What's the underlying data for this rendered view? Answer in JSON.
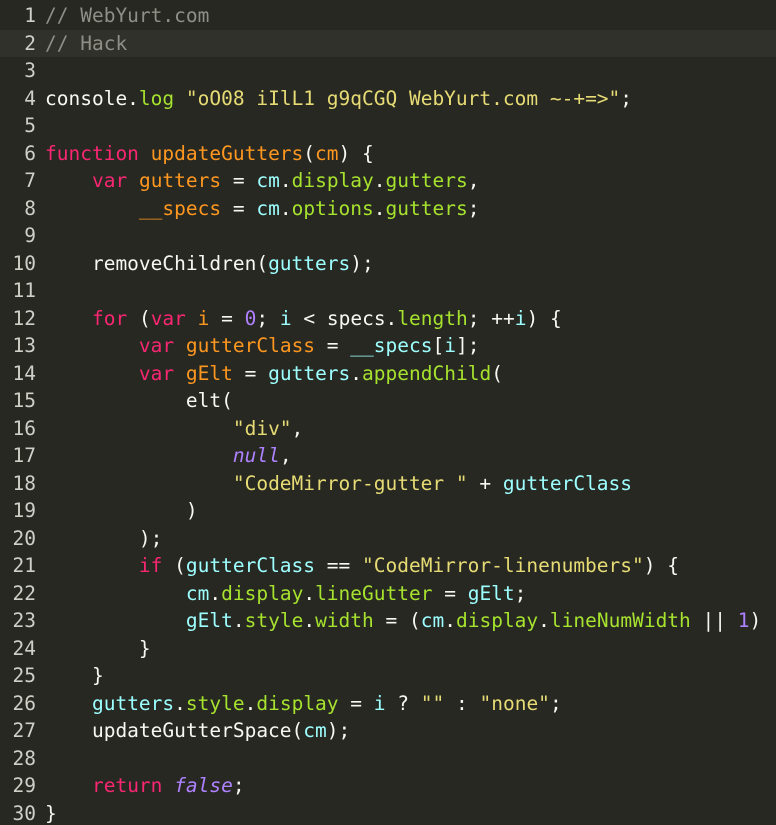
{
  "editor": {
    "theme": "monokai",
    "active_line": 2,
    "colors": {
      "background": "#272822",
      "active_line": "#30312b",
      "comment": "#8f8f87",
      "keyword": "#f92672",
      "definition": "#fd971f",
      "variable": "#a6e22e",
      "variable_2": "#9effff",
      "string": "#e6db74",
      "number": "#ae81ff"
    }
  },
  "lines": [
    [
      [
        "comment",
        "// WebYurt.com"
      ]
    ],
    [
      [
        "comment",
        "// Hack"
      ]
    ],
    [],
    [
      [
        "plain",
        "console."
      ],
      [
        "prop",
        "log"
      ],
      [
        "plain",
        " "
      ],
      [
        "string",
        "\"oO08 iIlL1 g9qCGQ WebYurt.com ~-+=>\""
      ],
      [
        "plain",
        ";"
      ]
    ],
    [],
    [
      [
        "keyword",
        "function"
      ],
      [
        "plain",
        " "
      ],
      [
        "def",
        "updateGutters"
      ],
      [
        "plain",
        "("
      ],
      [
        "def",
        "cm"
      ],
      [
        "plain",
        ") {"
      ]
    ],
    [
      [
        "plain",
        "    "
      ],
      [
        "keyword",
        "var"
      ],
      [
        "plain",
        " "
      ],
      [
        "def",
        "gutters"
      ],
      [
        "plain",
        " = "
      ],
      [
        "var2",
        "cm"
      ],
      [
        "plain",
        "."
      ],
      [
        "prop",
        "display"
      ],
      [
        "plain",
        "."
      ],
      [
        "prop",
        "gutters"
      ],
      [
        "plain",
        ","
      ]
    ],
    [
      [
        "plain",
        "        "
      ],
      [
        "def",
        "__specs"
      ],
      [
        "plain",
        " = "
      ],
      [
        "var2",
        "cm"
      ],
      [
        "plain",
        "."
      ],
      [
        "prop",
        "options"
      ],
      [
        "plain",
        "."
      ],
      [
        "prop",
        "gutters"
      ],
      [
        "plain",
        ";"
      ]
    ],
    [],
    [
      [
        "plain",
        "    removeChildren("
      ],
      [
        "var2",
        "gutters"
      ],
      [
        "plain",
        ");"
      ]
    ],
    [],
    [
      [
        "plain",
        "    "
      ],
      [
        "keyword",
        "for"
      ],
      [
        "plain",
        " ("
      ],
      [
        "keyword",
        "var"
      ],
      [
        "plain",
        " "
      ],
      [
        "def",
        "i"
      ],
      [
        "plain",
        " = "
      ],
      [
        "number",
        "0"
      ],
      [
        "plain",
        "; "
      ],
      [
        "var2",
        "i"
      ],
      [
        "plain",
        " < specs."
      ],
      [
        "prop",
        "length"
      ],
      [
        "plain",
        "; ++"
      ],
      [
        "var2",
        "i"
      ],
      [
        "plain",
        ") {"
      ]
    ],
    [
      [
        "plain",
        "        "
      ],
      [
        "keyword",
        "var"
      ],
      [
        "plain",
        " "
      ],
      [
        "def",
        "gutterClass"
      ],
      [
        "plain",
        " = "
      ],
      [
        "var2",
        "__specs"
      ],
      [
        "plain",
        "["
      ],
      [
        "var2",
        "i"
      ],
      [
        "plain",
        "];"
      ]
    ],
    [
      [
        "plain",
        "        "
      ],
      [
        "keyword",
        "var"
      ],
      [
        "plain",
        " "
      ],
      [
        "def",
        "gElt"
      ],
      [
        "plain",
        " = "
      ],
      [
        "var2",
        "gutters"
      ],
      [
        "plain",
        "."
      ],
      [
        "prop",
        "appendChild"
      ],
      [
        "plain",
        "("
      ]
    ],
    [
      [
        "plain",
        "            elt("
      ]
    ],
    [
      [
        "plain",
        "                "
      ],
      [
        "string",
        "\"div\""
      ],
      [
        "plain",
        ","
      ]
    ],
    [
      [
        "plain",
        "                "
      ],
      [
        "atom",
        "null"
      ],
      [
        "plain",
        ","
      ]
    ],
    [
      [
        "plain",
        "                "
      ],
      [
        "string",
        "\"CodeMirror-gutter \""
      ],
      [
        "plain",
        " + "
      ],
      [
        "var2",
        "gutterClass"
      ]
    ],
    [
      [
        "plain",
        "            )"
      ]
    ],
    [
      [
        "plain",
        "        );"
      ]
    ],
    [
      [
        "plain",
        "        "
      ],
      [
        "keyword",
        "if"
      ],
      [
        "plain",
        " ("
      ],
      [
        "var2",
        "gutterClass"
      ],
      [
        "plain",
        " == "
      ],
      [
        "string",
        "\"CodeMirror-linenumbers\""
      ],
      [
        "plain",
        ") {"
      ]
    ],
    [
      [
        "plain",
        "            "
      ],
      [
        "var2",
        "cm"
      ],
      [
        "plain",
        "."
      ],
      [
        "prop",
        "display"
      ],
      [
        "plain",
        "."
      ],
      [
        "prop",
        "lineGutter"
      ],
      [
        "plain",
        " = "
      ],
      [
        "var2",
        "gElt"
      ],
      [
        "plain",
        ";"
      ]
    ],
    [
      [
        "plain",
        "            "
      ],
      [
        "var2",
        "gElt"
      ],
      [
        "plain",
        "."
      ],
      [
        "prop",
        "style"
      ],
      [
        "plain",
        "."
      ],
      [
        "prop",
        "width"
      ],
      [
        "plain",
        " = ("
      ],
      [
        "var2",
        "cm"
      ],
      [
        "plain",
        "."
      ],
      [
        "prop",
        "display"
      ],
      [
        "plain",
        "."
      ],
      [
        "prop",
        "lineNumWidth"
      ],
      [
        "plain",
        " || "
      ],
      [
        "number",
        "1"
      ],
      [
        "plain",
        ")"
      ]
    ],
    [
      [
        "plain",
        "        }"
      ]
    ],
    [
      [
        "plain",
        "    }"
      ]
    ],
    [
      [
        "plain",
        "    "
      ],
      [
        "var2",
        "gutters"
      ],
      [
        "plain",
        "."
      ],
      [
        "prop",
        "style"
      ],
      [
        "plain",
        "."
      ],
      [
        "prop",
        "display"
      ],
      [
        "plain",
        " = "
      ],
      [
        "var2",
        "i"
      ],
      [
        "plain",
        " ? "
      ],
      [
        "string",
        "\"\""
      ],
      [
        "plain",
        " : "
      ],
      [
        "string",
        "\"none\""
      ],
      [
        "plain",
        ";"
      ]
    ],
    [
      [
        "plain",
        "    updateGutterSpace("
      ],
      [
        "var2",
        "cm"
      ],
      [
        "plain",
        ");"
      ]
    ],
    [],
    [
      [
        "plain",
        "    "
      ],
      [
        "keyword",
        "return"
      ],
      [
        "plain",
        " "
      ],
      [
        "atom",
        "false"
      ],
      [
        "plain",
        ";"
      ]
    ],
    [
      [
        "plain",
        "}"
      ]
    ]
  ]
}
